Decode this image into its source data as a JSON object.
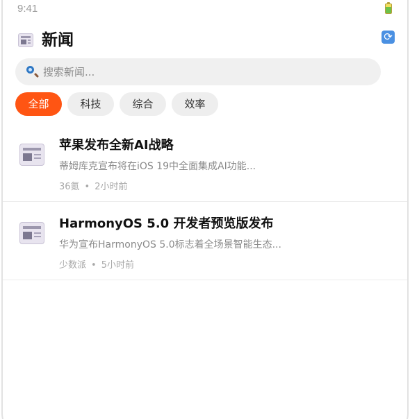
{
  "status_bar": {
    "time": "9:41"
  },
  "header": {
    "title": "新闻",
    "app_icon": "newspaper-icon",
    "refresh_icon": "refresh-icon"
  },
  "search": {
    "placeholder": "搜索新闻...",
    "value": "",
    "icon": "magnifier-icon"
  },
  "tabs": [
    {
      "label": "全部",
      "active": true
    },
    {
      "label": "科技",
      "active": false
    },
    {
      "label": "综合",
      "active": false
    },
    {
      "label": "效率",
      "active": false
    }
  ],
  "news": [
    {
      "icon": "newspaper-icon",
      "title": "苹果发布全新AI战略",
      "summary": "蒂姆库克宣布将在iOS 19中全面集成AI功能...",
      "source": "36氪",
      "separator": "•",
      "time": "2小时前"
    },
    {
      "icon": "newspaper-icon",
      "title": "HarmonyOS 5.0 开发者预览版发布",
      "summary": "华为宣布HarmonyOS 5.0标志着全场景智能生态...",
      "source": "少数派",
      "separator": "•",
      "time": "5小时前"
    }
  ],
  "colors": {
    "accent": "#ff5513",
    "tab_bg": "#eeeeee",
    "search_bg": "#f0f0f0",
    "refresh_bg": "#4a90e2"
  }
}
